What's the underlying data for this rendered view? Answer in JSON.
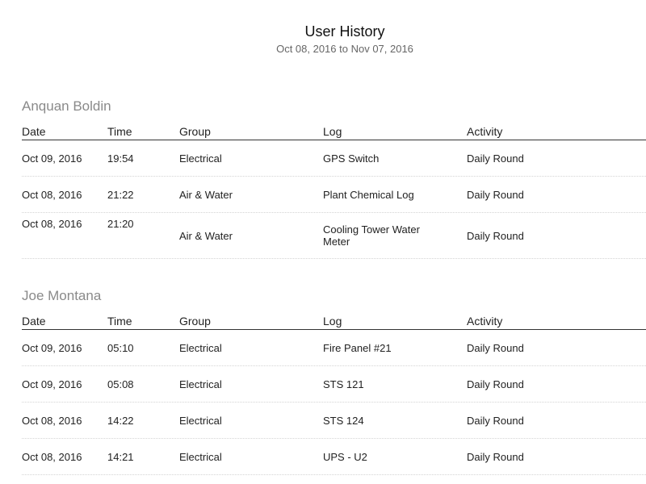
{
  "report": {
    "title": "User History",
    "date_range": "Oct 08, 2016 to Nov 07, 2016"
  },
  "columns": {
    "date": "Date",
    "time": "Time",
    "group": "Group",
    "log": "Log",
    "activity": "Activity"
  },
  "users": [
    {
      "name": "Anquan Boldin",
      "rows": [
        {
          "date": "Oct 09, 2016",
          "time": "19:54",
          "group": "Electrical",
          "log": "GPS Switch",
          "activity": "Daily Round"
        },
        {
          "date": "Oct 08, 2016",
          "time": "21:22",
          "group": "Air & Water",
          "log": "Plant Chemical Log",
          "activity": "Daily Round"
        },
        {
          "date": "Oct 08, 2016",
          "time": "21:20",
          "group": "Air & Water",
          "log": "Cooling Tower Water Meter",
          "activity": "Daily Round"
        }
      ]
    },
    {
      "name": "Joe Montana",
      "rows": [
        {
          "date": "Oct 09, 2016",
          "time": "05:10",
          "group": "Electrical",
          "log": "Fire Panel #21",
          "activity": "Daily Round"
        },
        {
          "date": "Oct 09, 2016",
          "time": "05:08",
          "group": "Electrical",
          "log": "STS 121",
          "activity": "Daily Round"
        },
        {
          "date": "Oct 08, 2016",
          "time": "14:22",
          "group": "Electrical",
          "log": "STS 124",
          "activity": "Daily Round"
        },
        {
          "date": "Oct 08, 2016",
          "time": "14:21",
          "group": "Electrical",
          "log": "UPS - U2",
          "activity": "Daily Round"
        }
      ]
    }
  ]
}
